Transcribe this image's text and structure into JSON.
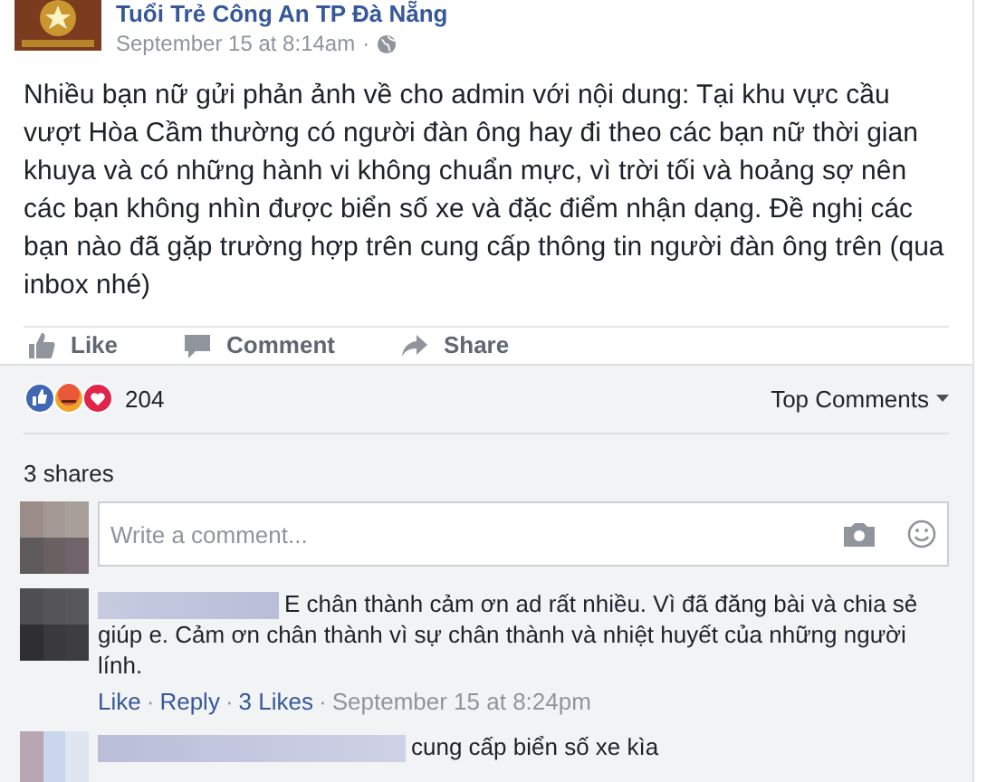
{
  "post": {
    "page_name": "Tuổi Trẻ Công An TP Đà Nẵng",
    "time": "September 15 at 8:14am",
    "separator": "·",
    "body": "Nhiều bạn nữ gửi phản ảnh về cho admin với nội dung: Tại khu vực cầu vượt Hòa Cầm thường có người đàn ông hay đi theo các bạn nữ thời gian khuya và có những hành vi không chuẩn mực, vì trời tối và hoảng sợ nên các bạn không nhìn được biển số xe và đặc điểm nhận dạng. Đề nghị các bạn nào đã gặp trường hợp trên cung cấp thông tin người đàn ông trên (qua inbox nhé)"
  },
  "actions": [
    {
      "kind": "like",
      "label": "Like"
    },
    {
      "kind": "comment",
      "label": "Comment"
    },
    {
      "kind": "share",
      "label": "Share"
    }
  ],
  "reactions": {
    "count": "204",
    "sort": "Top Comments"
  },
  "shares": "3 shares",
  "composer": {
    "placeholder": "Write a comment..."
  },
  "comments": [
    {
      "text": "E chân thành cảm ơn ad rất nhiều. Vì đã đăng bài và chia sẻ giúp e. Cảm ơn chân thành vì sự chân thành và nhiệt huyết của những người lính.",
      "like": "Like",
      "reply": "Reply",
      "likes": "3 Likes",
      "time": "September 15 at 8:24pm"
    },
    {
      "text": "cung cấp biển số xe kìa"
    }
  ]
}
